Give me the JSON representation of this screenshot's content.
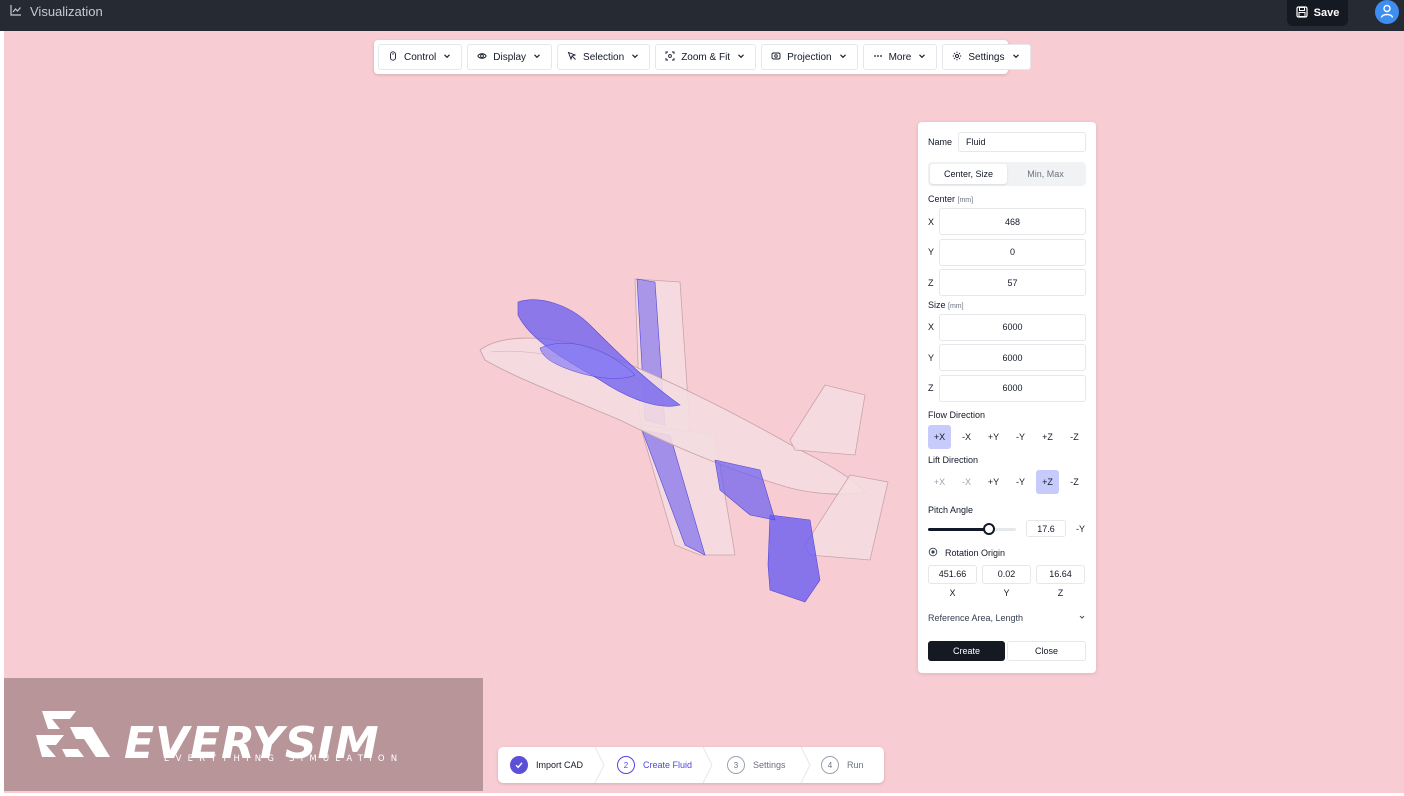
{
  "topbar": {
    "title": "Visualization",
    "save_label": "Save"
  },
  "toolbar": {
    "items": [
      {
        "label": "Control",
        "icon": "mouse-icon"
      },
      {
        "label": "Display",
        "icon": "eye-icon"
      },
      {
        "label": "Selection",
        "icon": "cursor-icon"
      },
      {
        "label": "Zoom & Fit",
        "icon": "focus-icon"
      },
      {
        "label": "Projection",
        "icon": "projection-icon"
      },
      {
        "label": "More",
        "icon": "ellipsis-icon"
      },
      {
        "label": "Settings",
        "icon": "gear-icon"
      }
    ]
  },
  "panel": {
    "name_label": "Name",
    "name_value": "Fluid",
    "tabs": [
      "Center, Size",
      "Min, Max"
    ],
    "active_tab": "Center, Size",
    "center": {
      "label": "Center",
      "unit": "[mm]",
      "x_label": "X",
      "x": "468",
      "y_label": "Y",
      "y": "0",
      "z_label": "Z",
      "z": "57"
    },
    "size": {
      "label": "Size",
      "unit": "[mm]",
      "x_label": "X",
      "x": "6000",
      "y_label": "Y",
      "y": "6000",
      "z_label": "Z",
      "z": "6000"
    },
    "flow_direction": {
      "label": "Flow Direction",
      "options": [
        "+X",
        "-X",
        "+Y",
        "-Y",
        "+Z",
        "-Z"
      ],
      "selected": "+X"
    },
    "lift_direction": {
      "label": "Lift Direction",
      "options": [
        "+X",
        "-X",
        "+Y",
        "-Y",
        "+Z",
        "-Z"
      ],
      "selected": "+Z",
      "disabled": [
        "+X",
        "-X"
      ]
    },
    "pitch": {
      "label": "Pitch Angle",
      "value": "17.6",
      "fraction": 0.69,
      "suffix": "-Y"
    },
    "rotation_origin": {
      "label": "Rotation Origin",
      "x_value": "451.66",
      "x_label": "X",
      "y_value": "0.02",
      "y_label": "Y",
      "z_value": "16.64",
      "z_label": "Z"
    },
    "reference_label": "Reference Area, Length",
    "create_label": "Create",
    "close_label": "Close"
  },
  "logo": {
    "name": "EVERYSIM",
    "tagline": "EVERYTHING SIMULATION"
  },
  "stepper": {
    "steps": [
      {
        "num": "",
        "label": "Import CAD",
        "state": "done"
      },
      {
        "num": "2",
        "label": "Create Fluid",
        "state": "current"
      },
      {
        "num": "3",
        "label": "Settings",
        "state": "todo"
      },
      {
        "num": "4",
        "label": "Run",
        "state": "todo"
      }
    ]
  },
  "colors": {
    "viewport_bg": "#f8ccd3",
    "topbar_bg": "#262a33",
    "accent": "#4f46e5",
    "selected_dir": "#c7cbfb",
    "aircraft_shell": "#f4dde0",
    "aircraft_selected": "#6a5cf0"
  }
}
